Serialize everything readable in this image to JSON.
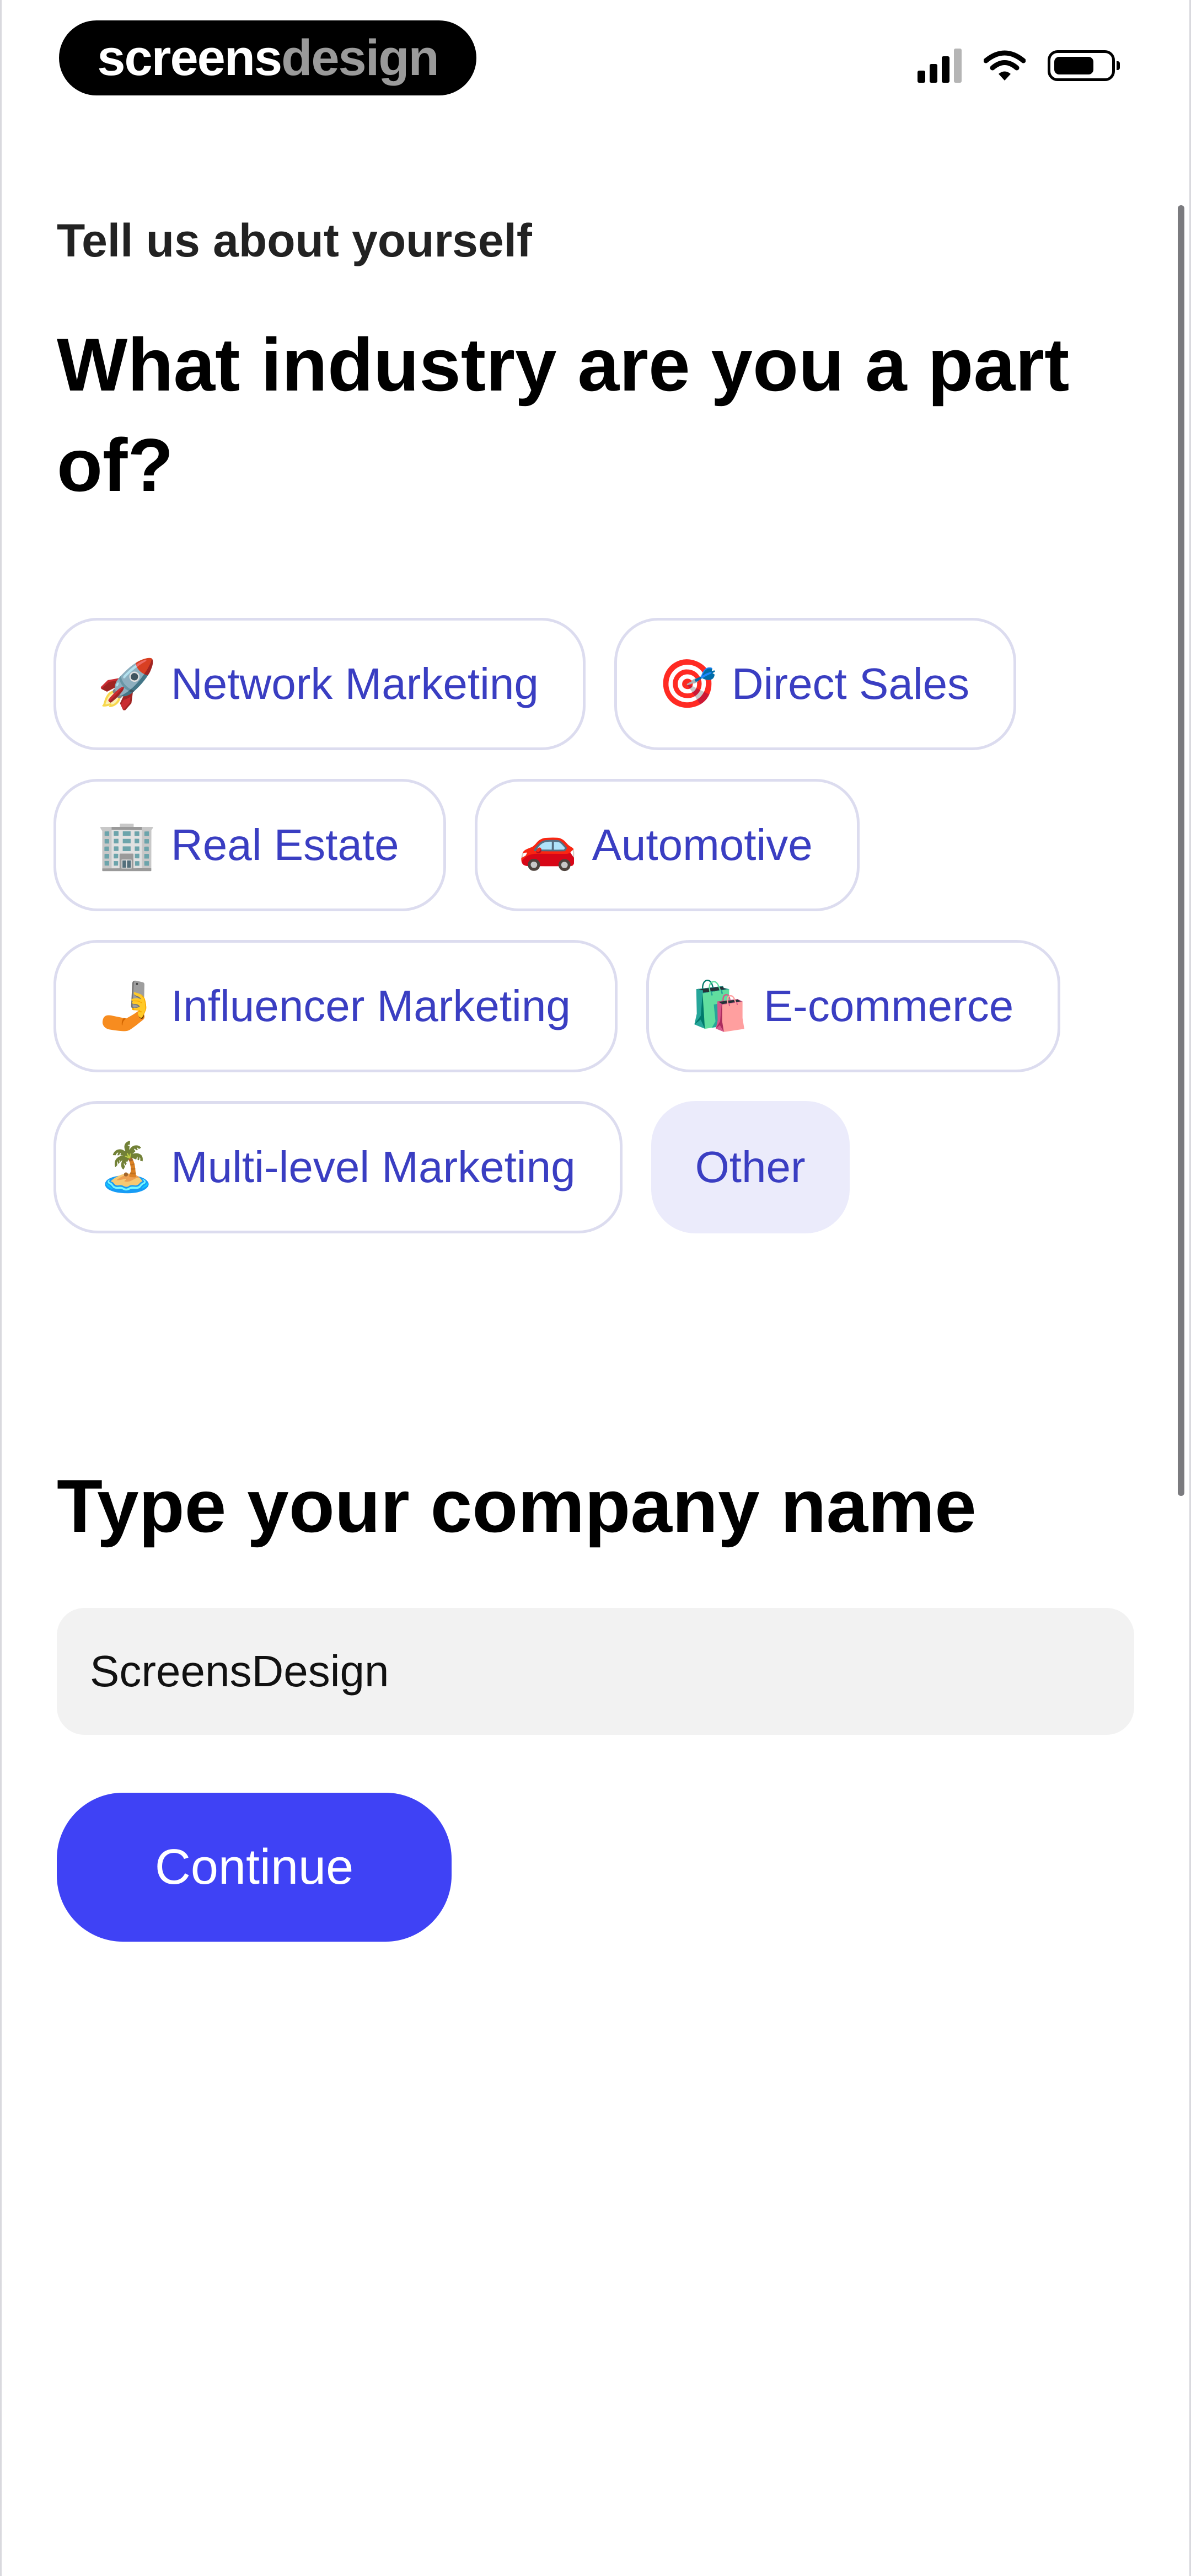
{
  "status_bar": {
    "brand_primary": "screens",
    "brand_secondary": "design",
    "icons": [
      "signal-icon",
      "wifi-icon",
      "battery-icon"
    ]
  },
  "header": {
    "eyebrow": "Tell us about yourself",
    "question": "What industry are you a part of?"
  },
  "industries": [
    {
      "icon": "rocket-icon",
      "glyph": "🚀",
      "label": "Network Marketing",
      "selected": false
    },
    {
      "icon": "target-icon",
      "glyph": "🎯",
      "label": "Direct Sales",
      "selected": false
    },
    {
      "icon": "office-building-icon",
      "glyph": "🏢",
      "label": "Real Estate",
      "selected": false
    },
    {
      "icon": "car-icon",
      "glyph": "🚗",
      "label": "Automotive",
      "selected": false
    },
    {
      "icon": "selfie-icon",
      "glyph": "🤳",
      "label": "Influencer Marketing",
      "selected": false
    },
    {
      "icon": "shopping-bags-icon",
      "glyph": "🛍️",
      "label": "E-commerce",
      "selected": false
    },
    {
      "icon": "island-icon",
      "glyph": "🏝️",
      "label": "Multi-level Marketing",
      "selected": false
    },
    {
      "icon": "",
      "glyph": "",
      "label": "Other",
      "selected": true
    }
  ],
  "company": {
    "title": "Type your company name",
    "value": "ScreensDesign",
    "placeholder": ""
  },
  "actions": {
    "continue_label": "Continue"
  },
  "colors": {
    "accent": "#3f42f5",
    "chip_text": "#3a3ec2",
    "chip_border": "#dcdcef",
    "chip_selected_bg": "#ebebfb",
    "input_bg": "#f2f2f2"
  }
}
